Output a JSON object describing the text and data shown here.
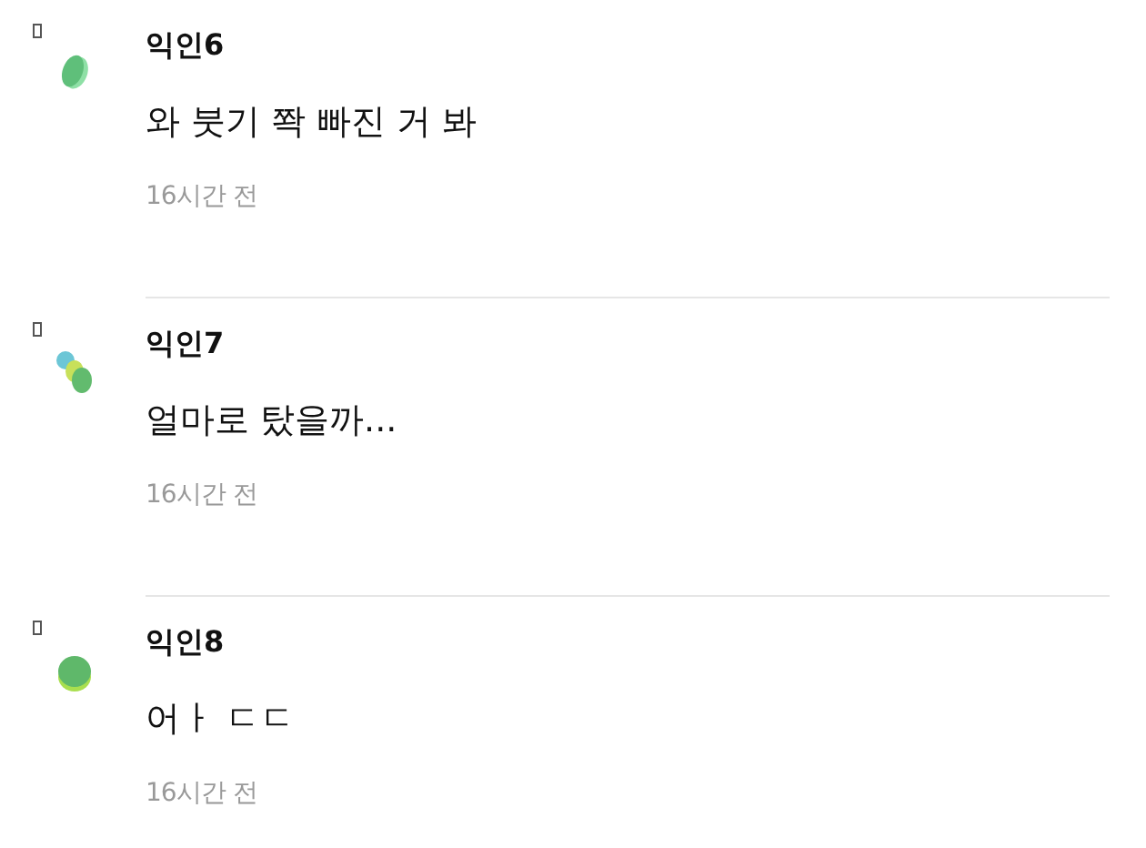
{
  "comments": [
    {
      "kind": "single",
      "author": "익인6",
      "text": "와 붓기 쫙 빠진 거 봐",
      "time": "16시간 전"
    },
    {
      "kind": "triple",
      "author": "익인7",
      "text": "얼마로 탔을까...",
      "time": "16시간 전"
    },
    {
      "kind": "stacked",
      "author": "익인8",
      "text": "어ㅏ ㄷㄷ",
      "time": "16시간 전"
    }
  ]
}
